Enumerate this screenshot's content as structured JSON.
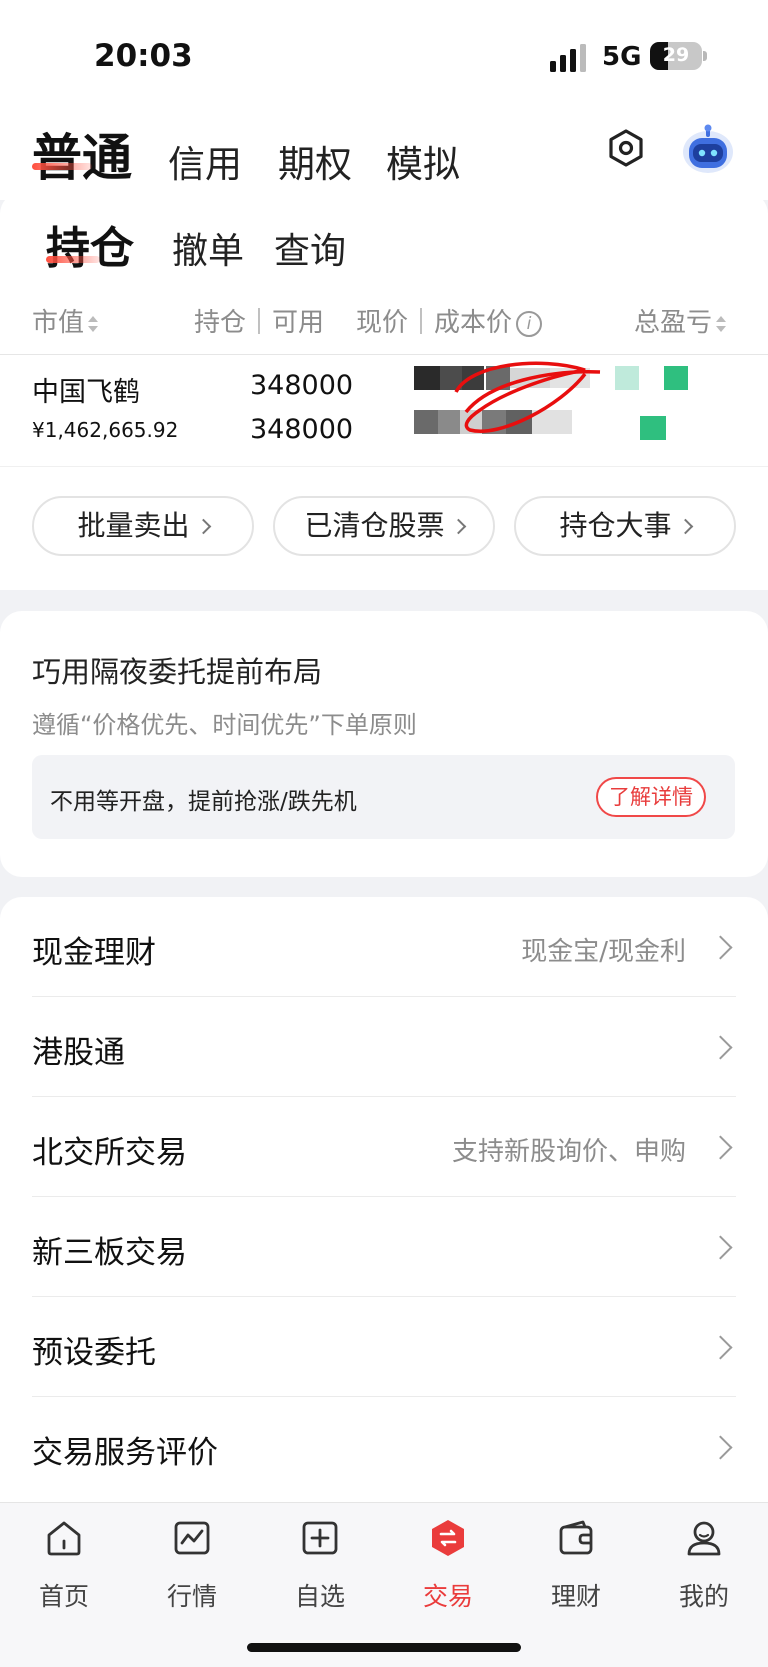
{
  "status_bar": {
    "time": "20:03",
    "network": "5G",
    "battery": "29"
  },
  "account_tabs": [
    {
      "label": "普通",
      "active": true
    },
    {
      "label": "信用"
    },
    {
      "label": "期权"
    },
    {
      "label": "模拟"
    }
  ],
  "header_icons": {
    "settings": "gear-icon",
    "assistant": "robot-icon"
  },
  "holdings": {
    "tabs": [
      {
        "label": "持仓",
        "active": true
      },
      {
        "label": "撤单"
      },
      {
        "label": "查询"
      }
    ],
    "columns": {
      "market_value": "市值",
      "position": "持仓｜可用",
      "price": "现价｜成本价",
      "pnl": "总盈亏"
    },
    "rows": [
      {
        "name": "中国飞鹤",
        "market_value": "¥1,462,665.92",
        "position": "348000",
        "available": "348000"
      }
    ],
    "buttons": [
      {
        "label": "批量卖出"
      },
      {
        "label": "已清仓股票"
      },
      {
        "label": "持仓大事"
      }
    ]
  },
  "promo": {
    "title": "巧用隔夜委托提前布局",
    "subtitle": "遵循“价格优先、时间优先”下单原则",
    "box_text": "不用等开盘，提前抢涨/跌先机",
    "button": "了解详情"
  },
  "menu": [
    {
      "label": "现金理财",
      "hint": "现金宝/现金利"
    },
    {
      "label": "港股通",
      "hint": ""
    },
    {
      "label": "北交所交易",
      "hint": "支持新股询价、申购"
    },
    {
      "label": "新三板交易",
      "hint": ""
    },
    {
      "label": "预设委托",
      "hint": ""
    },
    {
      "label": "交易服务评价",
      "hint": ""
    }
  ],
  "bottom_nav": [
    {
      "label": "首页",
      "icon": "home-icon"
    },
    {
      "label": "行情",
      "icon": "market-chart-icon"
    },
    {
      "label": "自选",
      "icon": "watchlist-add-icon"
    },
    {
      "label": "交易",
      "icon": "trade-icon",
      "active": true
    },
    {
      "label": "理财",
      "icon": "wallet-icon"
    },
    {
      "label": "我的",
      "icon": "profile-icon"
    }
  ],
  "colors": {
    "accent": "#ea3c3c",
    "pnl_redaction": "#2fbf7f"
  }
}
